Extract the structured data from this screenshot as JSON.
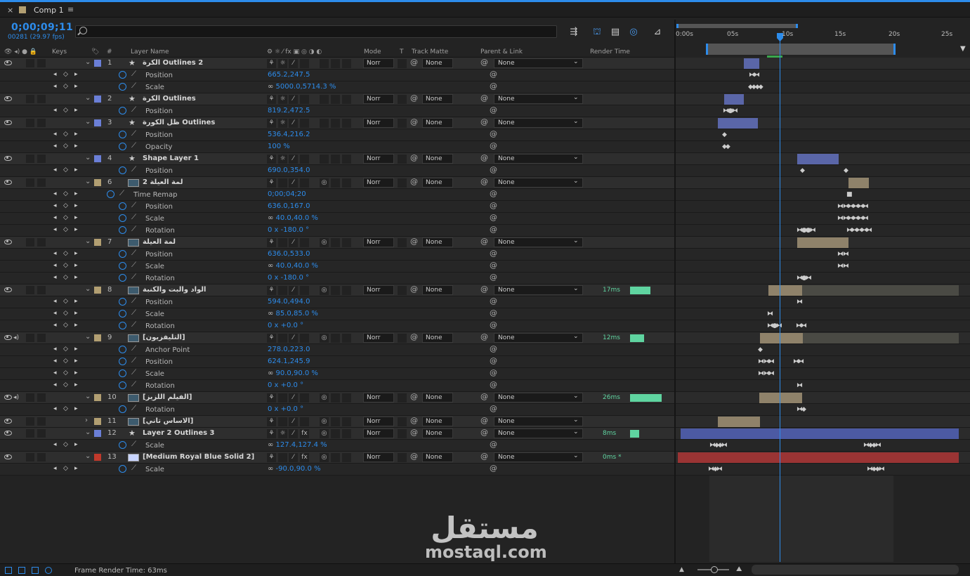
{
  "tab": {
    "close": "×",
    "title": "Comp 1",
    "menu": "≡",
    "swatch_color": "#b29f72"
  },
  "header": {
    "timecode": "0;00;09;11",
    "frameinfo": "00281 (29.97 fps)"
  },
  "columns": {
    "keys": "Keys",
    "num": "#",
    "layer_name": "Layer Name",
    "switches": "⚙ ☼ ⁄ fx ▣ ◎ ◑ ◐",
    "mode": "Mode",
    "t": "T",
    "track_matte": "Track Matte",
    "parent": "Parent & Link",
    "render_time": "Render Time"
  },
  "ruler": {
    "ticks": [
      "0:00s",
      "05s",
      "10s",
      "15s",
      "20s",
      "25s"
    ]
  },
  "colors": {
    "accent": "#2d8ceb",
    "render_green": "#5fd4a0",
    "label_blue": "#6b7fd7",
    "label_tan": "#b29f72",
    "label_red": "#c0392b"
  },
  "rows": [
    {
      "kind": "layer",
      "num": "1",
      "icon": "star",
      "label": "#6b7fd7",
      "name": "الكرة Outlines 2",
      "mode": "Norr",
      "matte": "None",
      "parent": "None",
      "render": "",
      "rbar": 0,
      "eye": true,
      "spk": false
    },
    {
      "kind": "prop",
      "name": "Position",
      "value": "665.2,247.5",
      "link": false
    },
    {
      "kind": "prop",
      "name": "Scale",
      "value": "5000.0,5714.3 %",
      "link": true
    },
    {
      "kind": "layer",
      "num": "2",
      "icon": "star",
      "label": "#6b7fd7",
      "name": "الكرة Outlines",
      "mode": "Norr",
      "matte": "None",
      "parent": "None",
      "render": "",
      "rbar": 0,
      "eye": true,
      "spk": false
    },
    {
      "kind": "prop",
      "name": "Position",
      "value": "819.2,472.5",
      "link": false
    },
    {
      "kind": "layer",
      "num": "3",
      "icon": "star",
      "label": "#6b7fd7",
      "name": "ظل الكورة Outlines",
      "mode": "Norr",
      "matte": "None",
      "parent": "None",
      "render": "",
      "rbar": 0,
      "eye": true,
      "spk": false
    },
    {
      "kind": "prop",
      "name": "Position",
      "value": "536.4,216.2",
      "link": false
    },
    {
      "kind": "prop",
      "name": "Opacity",
      "value": "100 %",
      "link": false
    },
    {
      "kind": "layer",
      "num": "4",
      "icon": "star",
      "label": "#6b7fd7",
      "name": "Shape Layer 1",
      "mode": "Norr",
      "matte": "None",
      "parent": "None",
      "render": "",
      "rbar": 0,
      "eye": true,
      "spk": false
    },
    {
      "kind": "prop",
      "name": "Position",
      "value": "690.0,354.0",
      "link": false
    },
    {
      "kind": "layer",
      "num": "6",
      "icon": "footage",
      "label": "#b29f72",
      "name": "لمة العيلة 2",
      "mode": "Norr",
      "matte": "None",
      "parent": "None",
      "render": "",
      "rbar": 0,
      "eye": true,
      "spk": false
    },
    {
      "kind": "prop",
      "name": "Time Remap",
      "value": "0;00;04;20",
      "link": false,
      "indent": true
    },
    {
      "kind": "prop",
      "name": "Position",
      "value": "636.0,167.0",
      "link": false
    },
    {
      "kind": "prop",
      "name": "Scale",
      "value": "40.0,40.0 %",
      "link": true
    },
    {
      "kind": "prop",
      "name": "Rotation",
      "value": "0 x -180.0 °",
      "link": false
    },
    {
      "kind": "layer",
      "num": "7",
      "icon": "footage",
      "label": "#b29f72",
      "name": "لمة العيلة",
      "mode": "Norr",
      "matte": "None",
      "parent": "None",
      "render": "",
      "rbar": 0,
      "eye": true,
      "spk": false
    },
    {
      "kind": "prop",
      "name": "Position",
      "value": "636.0,533.0",
      "link": false
    },
    {
      "kind": "prop",
      "name": "Scale",
      "value": "40.0,40.0 %",
      "link": true
    },
    {
      "kind": "prop",
      "name": "Rotation",
      "value": "0 x -180.0 °",
      "link": false
    },
    {
      "kind": "layer",
      "num": "8",
      "icon": "footage",
      "label": "#b29f72",
      "name": "الواد والبت والكنبة",
      "mode": "Norr",
      "matte": "None",
      "parent": "None",
      "render": "17ms",
      "rbar": 29,
      "eye": true,
      "spk": false
    },
    {
      "kind": "prop",
      "name": "Position",
      "value": "594.0,494.0",
      "link": false
    },
    {
      "kind": "prop",
      "name": "Scale",
      "value": "85.0,85.0 %",
      "link": true
    },
    {
      "kind": "prop",
      "name": "Rotation",
      "value": "0 x +0.0 °",
      "link": false
    },
    {
      "kind": "layer",
      "num": "9",
      "icon": "footage",
      "label": "#b29f72",
      "name": "[التليفزيون]",
      "mode": "Norr",
      "matte": "None",
      "parent": "None",
      "render": "12ms",
      "rbar": 20,
      "eye": true,
      "spk": true
    },
    {
      "kind": "prop",
      "name": "Anchor Point",
      "value": "278.0,223.0",
      "link": false
    },
    {
      "kind": "prop",
      "name": "Position",
      "value": "624.1,245.9",
      "link": false
    },
    {
      "kind": "prop",
      "name": "Scale",
      "value": "90.0,90.0 %",
      "link": true
    },
    {
      "kind": "prop",
      "name": "Rotation",
      "value": "0 x +0.0 °",
      "link": false
    },
    {
      "kind": "layer",
      "num": "10",
      "icon": "footage",
      "label": "#b29f72",
      "name": "[الفيلم اللزيز]",
      "mode": "Norr",
      "matte": "None",
      "parent": "None",
      "render": "26ms",
      "rbar": 45,
      "eye": true,
      "spk": true
    },
    {
      "kind": "prop",
      "name": "Rotation",
      "value": "0 x +0.0 °",
      "link": false
    },
    {
      "kind": "layer",
      "num": "11",
      "icon": "footage",
      "label": "#b29f72",
      "name": "[الاساس تاني]",
      "mode": "Norr",
      "matte": "None",
      "parent": "None",
      "render": "",
      "rbar": 0,
      "eye": true,
      "spk": false,
      "collapsed": true
    },
    {
      "kind": "layer",
      "num": "12",
      "icon": "star",
      "label": "#6b7fd7",
      "name": "Layer 2 Outlines 3",
      "mode": "Norr",
      "matte": "None",
      "parent": "None",
      "render": "8ms",
      "rbar": 13,
      "eye": true,
      "spk": false,
      "fx": true
    },
    {
      "kind": "prop",
      "name": "Scale",
      "value": "127.4,127.4 %",
      "link": true
    },
    {
      "kind": "layer",
      "num": "13",
      "icon": "solid",
      "label": "#c0392b",
      "name": "[Medium Royal Blue Solid 2]",
      "mode": "Norr",
      "matte": "None",
      "parent": "None",
      "render": "0ms *",
      "rbar": 0,
      "eye": true,
      "spk": false,
      "fx": true
    },
    {
      "kind": "prop",
      "name": "Scale",
      "value": "-90.0,90.0 %",
      "link": true
    }
  ],
  "bottom": {
    "frame_render": "Frame Render Time:  63ms"
  },
  "watermark": {
    "arabic": "مستقل",
    "latin": "mostaql.com"
  }
}
